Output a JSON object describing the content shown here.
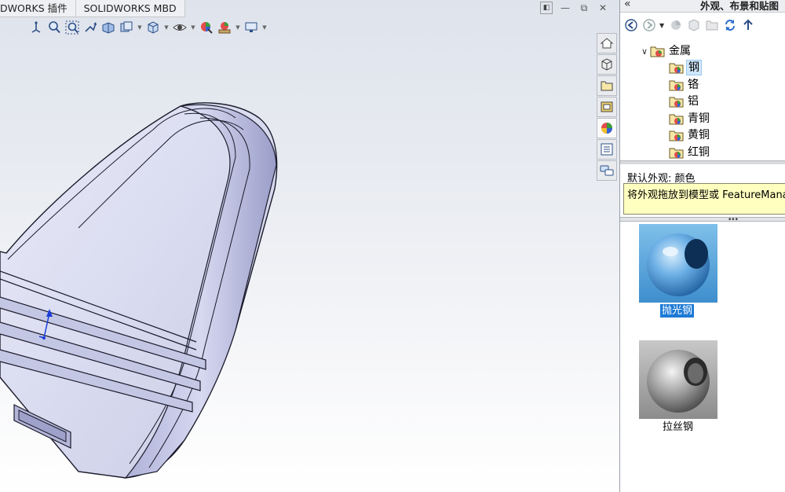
{
  "doc_tabs": [
    "DWORKS 插件",
    "SOLIDWORKS MBD"
  ],
  "heads_up_toolbar": [
    {
      "icon": "view-orientation-icon"
    },
    {
      "icon": "zoom-to-fit-icon"
    },
    {
      "icon": "zoom-to-area-icon"
    },
    {
      "icon": "previous-view-icon"
    },
    {
      "icon": "section-view-icon"
    },
    {
      "icon": "dynamic-annotation-views-icon"
    },
    {
      "icon": "view-orientation-cube-icon"
    },
    {
      "icon": "display-style-icon"
    },
    {
      "icon": "hide-show-items-icon"
    },
    {
      "icon": "edit-appearance-icon"
    },
    {
      "icon": "apply-scene-icon"
    },
    {
      "icon": "view-settings-icon"
    }
  ],
  "task_pane_tabs": [
    {
      "icon": "home-icon"
    },
    {
      "icon": "3d-parts-library-icon"
    },
    {
      "icon": "file-explorer-icon"
    },
    {
      "icon": "view-palette-icon"
    },
    {
      "icon": "appearances-icon"
    },
    {
      "icon": "custom-properties-icon"
    },
    {
      "icon": "forum-icon"
    }
  ],
  "panel": {
    "collapse_glyph": "«",
    "title": "外观、布景和贴图"
  },
  "tree": {
    "root": {
      "label": "金属",
      "expanded": true
    },
    "items": [
      {
        "label": "钢",
        "selected": true
      },
      {
        "label": "铬",
        "selected": false
      },
      {
        "label": "铝",
        "selected": false
      },
      {
        "label": "青铜",
        "selected": false
      },
      {
        "label": "黄铜",
        "selected": false
      },
      {
        "label": "红铜",
        "selected": false
      }
    ]
  },
  "info": {
    "label": "默认外观: 颜色",
    "tip": "将外观拖放到模型或 FeatureManager"
  },
  "gallery": [
    {
      "label": "抛光钢",
      "selected": true
    },
    {
      "label": "拉丝钢",
      "selected": false
    }
  ],
  "colors": {
    "accent": "#1c7ad6",
    "tip_bg": "#ffffbf",
    "model_face": "#d9dcf2"
  }
}
